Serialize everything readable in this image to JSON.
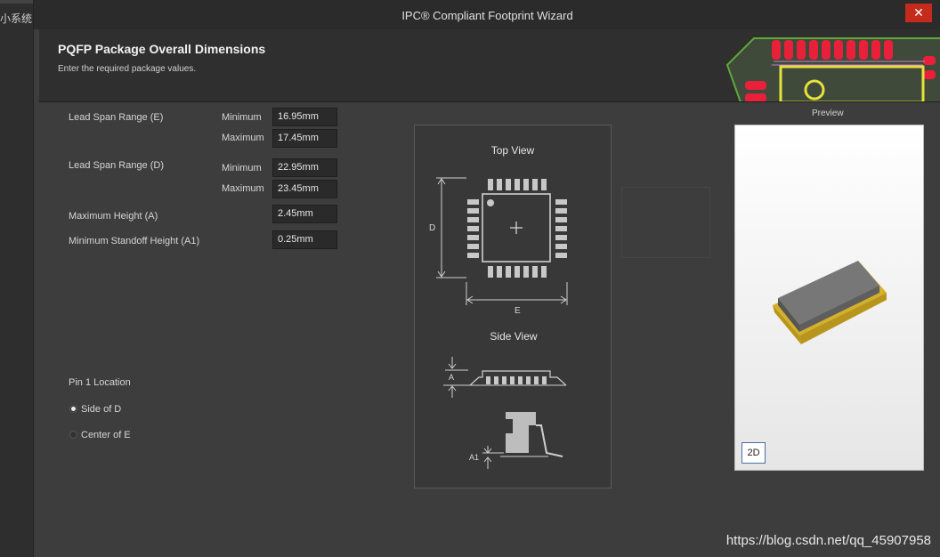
{
  "background_app": {
    "sidebar_text": "小系统"
  },
  "window": {
    "title": "IPC® Compliant Footprint Wizard",
    "close_glyph": "✕"
  },
  "header": {
    "title": "PQFP Package Overall Dimensions",
    "subtitle": "Enter the required package values."
  },
  "form": {
    "lead_span_e": {
      "label": "Lead Span Range (E)",
      "min_label": "Minimum",
      "min_value": "16.95mm",
      "max_label": "Maximum",
      "max_value": "17.45mm"
    },
    "lead_span_d": {
      "label": "Lead Span Range (D)",
      "min_label": "Minimum",
      "min_value": "22.95mm",
      "max_label": "Maximum",
      "max_value": "23.45mm"
    },
    "max_height": {
      "label": "Maximum Height (A)",
      "value": "2.45mm"
    },
    "min_standoff": {
      "label": "Minimum Standoff Height (A1)",
      "value": "0.25mm"
    }
  },
  "pin1": {
    "label": "Pin 1 Location",
    "options": [
      {
        "label": "Side of D",
        "selected": true
      },
      {
        "label": "Center of E",
        "selected": false
      }
    ]
  },
  "diagram": {
    "top_view_label": "Top View",
    "side_view_label": "Side View",
    "dim_d": "D",
    "dim_e": "E",
    "dim_a": "A",
    "dim_a1": "A1"
  },
  "preview": {
    "label": "Preview",
    "mode_button": "2D"
  },
  "watermark": "https://blog.csdn.net/qq_45907958",
  "colors": {
    "close_red": "#c42b1c",
    "pcb_pad_red": "#e8203a",
    "pcb_trace_yellow": "#e6e23c",
    "chip_body": "#6a6a6a",
    "chip_leads": "#d4b12a"
  }
}
